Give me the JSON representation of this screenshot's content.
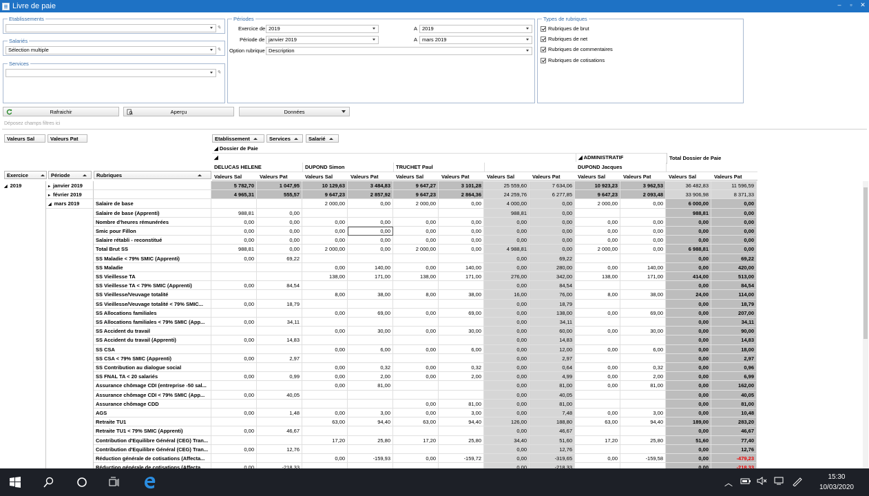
{
  "window": {
    "title": "Livre de paie",
    "controls": [
      "‒",
      "▫",
      "✕"
    ]
  },
  "filters": {
    "etablissements": {
      "label": "Etablissements",
      "value": ""
    },
    "salaries": {
      "label": "Salariés",
      "value": "Sélection multiple"
    },
    "services": {
      "label": "Services",
      "value": ""
    }
  },
  "periodes": {
    "label": "Périodes",
    "exercice_label": "Exercice de",
    "exercice_value": "2019",
    "a_label": "A",
    "a_exercice_value": "2019",
    "periode_label": "Période de",
    "periode_value": "janvier 2019",
    "a_periode_value": "mars 2019",
    "option_label": "Option rubrique",
    "option_value": "Description"
  },
  "types": {
    "label": "Types de rubriques",
    "items": [
      "Rubriques de brut",
      "Rubriques de net",
      "Rubriques de commentaires",
      "Rubriques de cotisations"
    ]
  },
  "buttons": {
    "refresh": "Rafraichir",
    "preview": "Aperçu",
    "data": "Données"
  },
  "dropzone": "Déposez champs filtres ici",
  "data_fields": [
    "Valeurs Sal",
    "Valeurs Pat"
  ],
  "column_fields": [
    "Etablissement",
    "Services",
    "Salarié"
  ],
  "row_fields": [
    "Exercice",
    "Période",
    "Rubriques"
  ],
  "pivot": {
    "dossier": "Dossier de Paie",
    "service_admin": "ADMINISTRATIF",
    "total": "Total Dossier de Paie",
    "employees": [
      "DELUCAS HELENE",
      "DUPOND Simon",
      "TRUCHET Paul",
      "",
      "DUPOND Jacques"
    ],
    "sal": "Valeurs Sal",
    "pat": "Valeurs Pat"
  },
  "rows": [
    {
      "ex": "2019",
      "per": "janvier 2019",
      "rub": "",
      "kind": "month",
      "v": [
        "5 782,70",
        "1 047,95",
        "10 129,63",
        "3 484,83",
        "9 647,27",
        "3 101,28",
        "25 559,60",
        "7 634,06",
        "10 923,23",
        "3 962,53",
        "36 482,83",
        "11 596,59"
      ]
    },
    {
      "ex": "",
      "per": "février 2019",
      "rub": "",
      "kind": "month",
      "v": [
        "4 965,31",
        "555,57",
        "9 647,23",
        "2 857,92",
        "9 647,23",
        "2 864,36",
        "24 259,76",
        "6 277,85",
        "9 647,23",
        "2 093,48",
        "33 906,98",
        "8 371,33"
      ]
    },
    {
      "ex": "",
      "per": "mars 2019",
      "rub": "Salaire de base",
      "v": [
        "",
        "",
        "2 000,00",
        "0,00",
        "2 000,00",
        "0,00",
        "4 000,00",
        "0,00",
        "2 000,00",
        "0,00",
        "6 000,00",
        "0,00"
      ]
    },
    {
      "rub": "Salaire de base (Apprenti)",
      "v": [
        "988,81",
        "0,00",
        "",
        "",
        "",
        "",
        "988,81",
        "0,00",
        "",
        "",
        "988,81",
        "0,00"
      ]
    },
    {
      "rub": "Nombre d'heures rémunérées",
      "v": [
        "0,00",
        "0,00",
        "0,00",
        "0,00",
        "0,00",
        "0,00",
        "0,00",
        "0,00",
        "0,00",
        "0,00",
        "0,00",
        "0,00"
      ]
    },
    {
      "rub": "Smic pour Fillon",
      "v": [
        "0,00",
        "0,00",
        "0,00",
        "0,00",
        "0,00",
        "0,00",
        "0,00",
        "0,00",
        "0,00",
        "0,00",
        "0,00",
        "0,00"
      ]
    },
    {
      "rub": "Salaire rétabli - reconstitué",
      "v": [
        "0,00",
        "0,00",
        "0,00",
        "0,00",
        "0,00",
        "0,00",
        "0,00",
        "0,00",
        "0,00",
        "0,00",
        "0,00",
        "0,00"
      ]
    },
    {
      "rub": "Total Brut SS",
      "v": [
        "988,81",
        "0,00",
        "2 000,00",
        "0,00",
        "2 000,00",
        "0,00",
        "4 988,81",
        "0,00",
        "2 000,00",
        "0,00",
        "6 988,81",
        "0,00"
      ]
    },
    {
      "rub": "SS Maladie < 79% SMIC (Apprenti)",
      "v": [
        "0,00",
        "69,22",
        "",
        "",
        "",
        "",
        "0,00",
        "69,22",
        "",
        "",
        "0,00",
        "69,22"
      ]
    },
    {
      "rub": "SS Maladie",
      "v": [
        "",
        "",
        "0,00",
        "140,00",
        "0,00",
        "140,00",
        "0,00",
        "280,00",
        "0,00",
        "140,00",
        "0,00",
        "420,00"
      ]
    },
    {
      "rub": "SS Vieillesse TA",
      "v": [
        "",
        "",
        "138,00",
        "171,00",
        "138,00",
        "171,00",
        "276,00",
        "342,00",
        "138,00",
        "171,00",
        "414,00",
        "513,00"
      ]
    },
    {
      "rub": "SS Vieillesse TA < 79% SMIC (Apprenti)",
      "v": [
        "0,00",
        "84,54",
        "",
        "",
        "",
        "",
        "0,00",
        "84,54",
        "",
        "",
        "0,00",
        "84,54"
      ]
    },
    {
      "rub": "SS Vieillesse/Veuvage totalité",
      "v": [
        "",
        "",
        "8,00",
        "38,00",
        "8,00",
        "38,00",
        "16,00",
        "76,00",
        "8,00",
        "38,00",
        "24,00",
        "114,00"
      ]
    },
    {
      "rub": "SS Vieillesse/Veuvage totalité < 79% SMIC...",
      "v": [
        "0,00",
        "18,79",
        "",
        "",
        "",
        "",
        "0,00",
        "18,79",
        "",
        "",
        "0,00",
        "18,79"
      ]
    },
    {
      "rub": "SS Allocations familiales",
      "v": [
        "",
        "",
        "0,00",
        "69,00",
        "0,00",
        "69,00",
        "0,00",
        "138,00",
        "0,00",
        "69,00",
        "0,00",
        "207,00"
      ]
    },
    {
      "rub": "SS Allocations familiales < 79% SMIC (App...",
      "v": [
        "0,00",
        "34,11",
        "",
        "",
        "",
        "",
        "0,00",
        "34,11",
        "",
        "",
        "0,00",
        "34,11"
      ]
    },
    {
      "rub": "SS Accident du travail",
      "v": [
        "",
        "",
        "0,00",
        "30,00",
        "0,00",
        "30,00",
        "0,00",
        "60,00",
        "0,00",
        "30,00",
        "0,00",
        "90,00"
      ]
    },
    {
      "rub": "SS Accident du travail (Apprenti)",
      "v": [
        "0,00",
        "14,83",
        "",
        "",
        "",
        "",
        "0,00",
        "14,83",
        "",
        "",
        "0,00",
        "14,83"
      ]
    },
    {
      "rub": "SS CSA",
      "v": [
        "",
        "",
        "0,00",
        "6,00",
        "0,00",
        "6,00",
        "0,00",
        "12,00",
        "0,00",
        "6,00",
        "0,00",
        "18,00"
      ]
    },
    {
      "rub": "SS CSA < 79% SMIC (Apprenti)",
      "v": [
        "0,00",
        "2,97",
        "",
        "",
        "",
        "",
        "0,00",
        "2,97",
        "",
        "",
        "0,00",
        "2,97"
      ]
    },
    {
      "rub": "SS Contribution au dialogue social",
      "v": [
        "",
        "",
        "0,00",
        "0,32",
        "0,00",
        "0,32",
        "0,00",
        "0,64",
        "0,00",
        "0,32",
        "0,00",
        "0,96"
      ]
    },
    {
      "rub": "SS FNAL TA < 20 salariés",
      "v": [
        "0,00",
        "0,99",
        "0,00",
        "2,00",
        "0,00",
        "2,00",
        "0,00",
        "4,99",
        "0,00",
        "2,00",
        "0,00",
        "6,99"
      ]
    },
    {
      "rub": "Assurance chômage CDI (entreprise -50 sal...",
      "v": [
        "",
        "",
        "0,00",
        "81,00",
        "",
        "",
        "0,00",
        "81,00",
        "0,00",
        "81,00",
        "0,00",
        "162,00"
      ]
    },
    {
      "rub": "Assurance chômage CDI < 79% SMIC (App...",
      "v": [
        "0,00",
        "40,05",
        "",
        "",
        "",
        "",
        "0,00",
        "40,05",
        "",
        "",
        "0,00",
        "40,05"
      ]
    },
    {
      "rub": "Assurance chômage CDD",
      "v": [
        "",
        "",
        "",
        "",
        "0,00",
        "81,00",
        "0,00",
        "81,00",
        "",
        "",
        "0,00",
        "81,00"
      ]
    },
    {
      "rub": "AGS",
      "v": [
        "0,00",
        "1,48",
        "0,00",
        "3,00",
        "0,00",
        "3,00",
        "0,00",
        "7,48",
        "0,00",
        "3,00",
        "0,00",
        "10,48"
      ]
    },
    {
      "rub": "Retraite TU1",
      "v": [
        "",
        "",
        "63,00",
        "94,40",
        "63,00",
        "94,40",
        "126,00",
        "188,80",
        "63,00",
        "94,40",
        "189,00",
        "283,20"
      ]
    },
    {
      "rub": "Retraite TU1 < 79% SMIC (Apprenti)",
      "v": [
        "0,00",
        "46,67",
        "",
        "",
        "",
        "",
        "0,00",
        "46,67",
        "",
        "",
        "0,00",
        "46,67"
      ]
    },
    {
      "rub": "Contribution d'Equilibre Général (CEG) Tran...",
      "v": [
        "",
        "",
        "17,20",
        "25,80",
        "17,20",
        "25,80",
        "34,40",
        "51,60",
        "17,20",
        "25,80",
        "51,60",
        "77,40"
      ]
    },
    {
      "rub": "Contribution d'Equilibre Général (CEG) Tran...",
      "v": [
        "0,00",
        "12,76",
        "",
        "",
        "",
        "",
        "0,00",
        "12,76",
        "",
        "",
        "0,00",
        "12,76"
      ]
    },
    {
      "rub": "Réduction générale de cotisations (Affecta...",
      "v": [
        "",
        "",
        "0,00",
        "-159,93",
        "0,00",
        "-159,72",
        "0,00",
        "-319,65",
        "0,00",
        "-159,58",
        "0,00",
        "-479,23"
      ]
    },
    {
      "rub": "Réduction générale de cotisations (Affecta...",
      "v": [
        "0,00",
        "-218,33",
        "",
        "",
        "",
        "",
        "0,00",
        "-218,33",
        "",
        "",
        "0,00",
        "-218,33"
      ]
    }
  ],
  "taskbar": {
    "time": "15:30",
    "date": "10/03/2020"
  },
  "colors": {
    "titlebar": "#1e72c5",
    "subtotal": "#d6d6d6",
    "total": "#bdbdbd",
    "negative": "#e00000"
  }
}
